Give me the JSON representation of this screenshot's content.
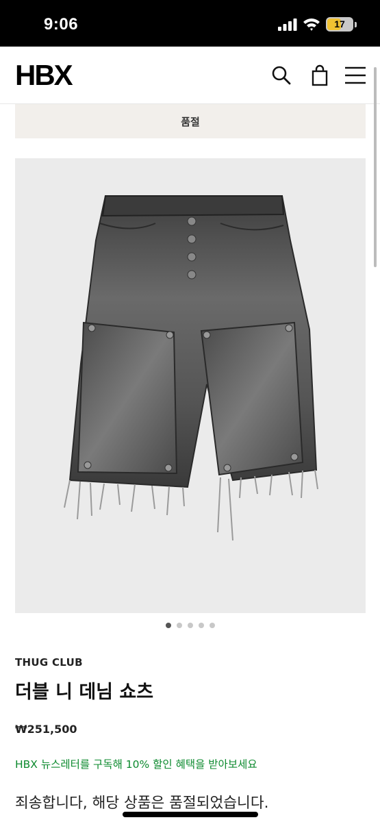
{
  "status_bar": {
    "time": "9:06",
    "battery": "17",
    "battery_level": 0.17,
    "icons": [
      "signal-icon",
      "wifi-icon",
      "battery-icon"
    ]
  },
  "nav": {
    "logo": "HBX",
    "icons": [
      "search-icon",
      "shopping-bag-icon",
      "hamburger-menu-icon"
    ]
  },
  "banner": {
    "label": "품절"
  },
  "gallery": {
    "image_count": 5,
    "active_index": 0,
    "image": "gray distressed denim shorts"
  },
  "product": {
    "brand": "THUG CLUB",
    "name": "더블 니 데님 쇼츠",
    "price": "₩251,500",
    "newsletter": "HBX 뉴스레터를 구독해 10% 할인 혜택을 받아보세요",
    "sold_out_message": "죄송합니다, 해당 상품은 품절되었습니다."
  },
  "colors": {
    "accent_green": "#0c8a2e",
    "banner_bg": "#f2efeb",
    "image_bg": "#ebebeb"
  }
}
